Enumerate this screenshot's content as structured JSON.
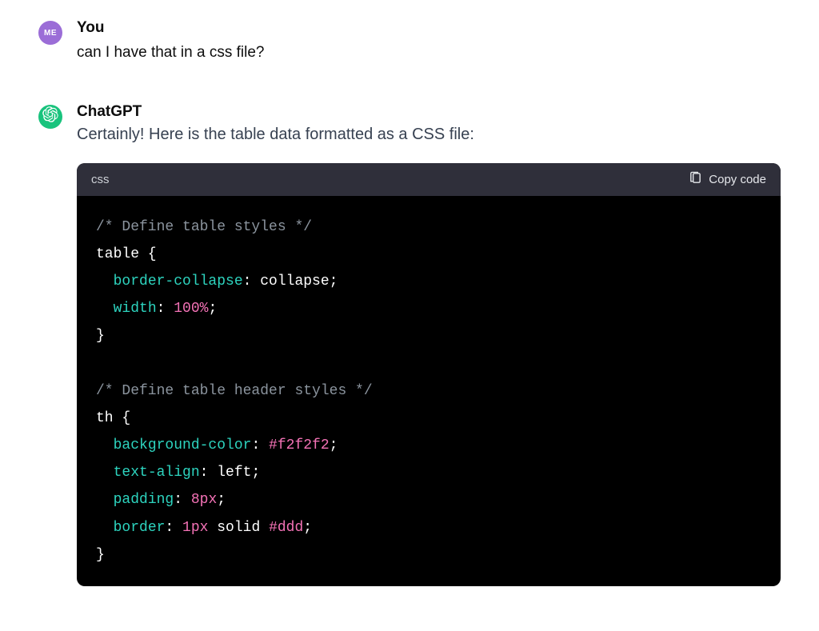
{
  "user": {
    "avatar_text": "ME",
    "name": "You",
    "message": "can I have that in a css file?"
  },
  "assistant": {
    "name": "ChatGPT",
    "intro": "Certainly! Here is the table data formatted as a CSS file:"
  },
  "code": {
    "language": "css",
    "copy_label": "Copy code",
    "tokens": {
      "c1": "/* Define table styles */",
      "sel1": "table {",
      "p1": "border-collapse",
      "v1": "collapse",
      "p2": "width",
      "n2": "100%",
      "close1": "}",
      "c2": "/* Define table header styles */",
      "sel2": "th {",
      "p3": "background-color",
      "n3": "#f2f2f2",
      "p4": "text-align",
      "v4": "left",
      "p5": "padding",
      "n5": "8px",
      "p6": "border",
      "n6a": "1px",
      "v6b": "solid",
      "n6c": "#ddd",
      "close2": "}"
    }
  }
}
